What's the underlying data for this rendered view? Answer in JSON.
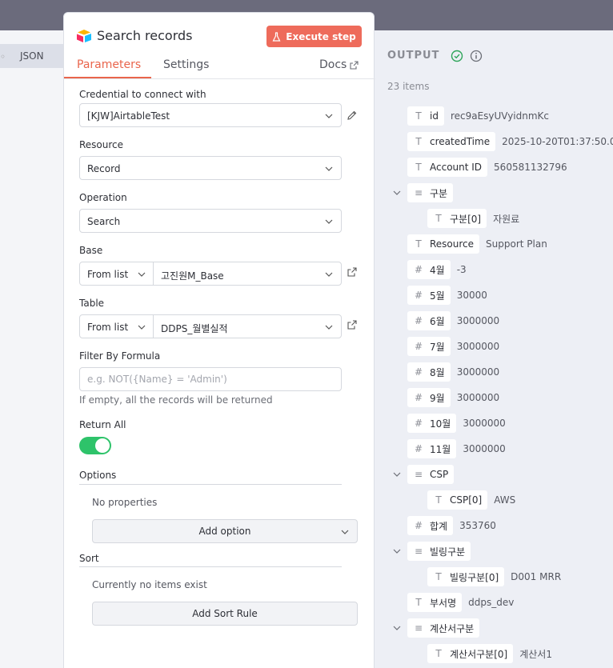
{
  "background": {
    "json_label": "JSON",
    "sep": "◦"
  },
  "panel": {
    "title": "Search records",
    "execute_label": "Execute step",
    "tabs": [
      "Parameters",
      "Settings"
    ],
    "docs_label": "Docs"
  },
  "fields": {
    "credential": {
      "label": "Credential to connect with",
      "value": "[KJW]AirtableTest"
    },
    "resource": {
      "label": "Resource",
      "value": "Record"
    },
    "operation": {
      "label": "Operation",
      "value": "Search"
    },
    "base": {
      "label": "Base",
      "mode": "From list",
      "value": "고진원M_Base"
    },
    "table": {
      "label": "Table",
      "mode": "From list",
      "value": "DDPS_월별실적"
    },
    "formula": {
      "label": "Filter By Formula",
      "placeholder": "e.g. NOT({Name} = 'Admin')",
      "hint": "If empty, all the records will be returned"
    },
    "return_all": {
      "label": "Return All",
      "on": true
    }
  },
  "options": {
    "title": "Options",
    "empty": "No properties",
    "button": "Add option"
  },
  "sort": {
    "title": "Sort",
    "empty": "Currently no items exist",
    "button": "Add Sort Rule"
  },
  "output": {
    "title": "OUTPUT",
    "count": "23 items",
    "rows": [
      {
        "type": "T",
        "key": "id",
        "value": "rec9aEsyUVyidnmKc"
      },
      {
        "type": "T",
        "key": "createdTime",
        "value": "2025-10-20T01:37:50.000"
      },
      {
        "type": "T",
        "key": "Account ID",
        "value": "560581132796"
      },
      {
        "type": "≡",
        "key": "구분",
        "value": "",
        "expandable": true
      },
      {
        "type": "T",
        "key": "구분[0]",
        "value": "자원료",
        "child": true
      },
      {
        "type": "T",
        "key": "Resource",
        "value": "Support Plan"
      },
      {
        "type": "#",
        "key": "4월",
        "value": "-3"
      },
      {
        "type": "#",
        "key": "5월",
        "value": "30000"
      },
      {
        "type": "#",
        "key": "6월",
        "value": "3000000"
      },
      {
        "type": "#",
        "key": "7월",
        "value": "3000000"
      },
      {
        "type": "#",
        "key": "8월",
        "value": "3000000"
      },
      {
        "type": "#",
        "key": "9월",
        "value": "3000000"
      },
      {
        "type": "#",
        "key": "10월",
        "value": "3000000"
      },
      {
        "type": "#",
        "key": "11월",
        "value": "3000000"
      },
      {
        "type": "≡",
        "key": "CSP",
        "value": "",
        "expandable": true
      },
      {
        "type": "T",
        "key": "CSP[0]",
        "value": "AWS",
        "child": true
      },
      {
        "type": "#",
        "key": "합계",
        "value": "353760"
      },
      {
        "type": "≡",
        "key": "빌링구분",
        "value": "",
        "expandable": true
      },
      {
        "type": "T",
        "key": "빌링구분[0]",
        "value": "D001 MRR",
        "child": true
      },
      {
        "type": "T",
        "key": "부서명",
        "value": "ddps_dev"
      },
      {
        "type": "≡",
        "key": "계산서구분",
        "value": "",
        "expandable": true
      },
      {
        "type": "T",
        "key": "계산서구분[0]",
        "value": "계산서1",
        "child": true
      }
    ]
  },
  "colors": {
    "accent": "#ee6b5b",
    "tab_active": "#e9654c",
    "toggle_on": "#2ec36a",
    "success": "#2ea55a"
  },
  "icons": [
    "airtable-icon",
    "flask-icon",
    "external-link-icon",
    "pencil-icon",
    "chevron-down-icon",
    "check-circle-icon",
    "info-icon"
  ]
}
